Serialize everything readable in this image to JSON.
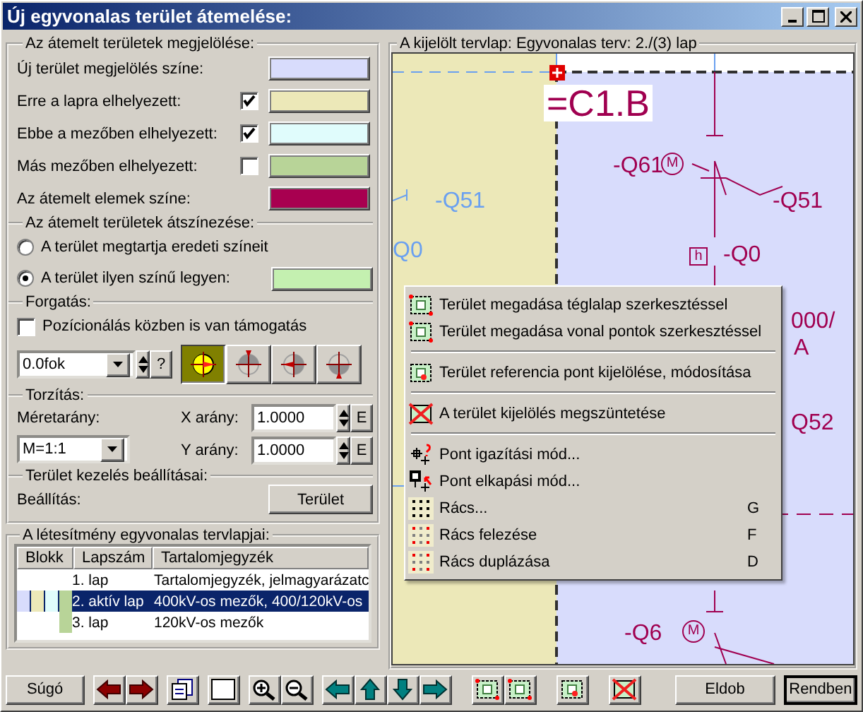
{
  "window": {
    "title": "Új egyvonalas terület átemelése:"
  },
  "marking": {
    "legend": "Az átemelt területek megjelölése:",
    "rows": [
      {
        "kind": "plain",
        "label": "Új terület megjelölés színe:",
        "color": "#d8dcfc"
      },
      {
        "kind": "check",
        "label": "Erre a lapra elhelyezett:",
        "checked": true,
        "color": "#ece8b8"
      },
      {
        "kind": "check",
        "label": "Ebbe a mezőben elhelyezett:",
        "checked": true,
        "color": "#e0fcfc"
      },
      {
        "kind": "check",
        "label": "Más mezőben elhelyezett:",
        "checked": false,
        "color": "#b8d498"
      },
      {
        "kind": "plain",
        "label": "Az átemelt elemek színe:",
        "color": "#a80050"
      }
    ]
  },
  "recolor": {
    "legend": "Az átemelt területek átszínezése:",
    "options": [
      {
        "label": "A terület megtartja eredeti színeit",
        "selected": false
      },
      {
        "label": "A terület ilyen színű legyen:",
        "selected": true,
        "color": "#c4f0b0"
      }
    ]
  },
  "rotation": {
    "legend": "Forgatás:",
    "support": {
      "label": "Pozícionálás közben is van támogatás",
      "checked": false
    },
    "angle": "0.0fok",
    "help": "?",
    "directions": [
      {
        "kind": "right",
        "selected": true
      },
      {
        "kind": "up",
        "selected": false
      },
      {
        "kind": "left",
        "selected": false
      },
      {
        "kind": "down",
        "selected": false
      }
    ]
  },
  "distortion": {
    "legend": "Torzítás:",
    "scale_label": "Méretarány:",
    "scale": "M=1:1",
    "ratios": [
      {
        "label": "X arány:",
        "value": "1.0000",
        "button": "E"
      },
      {
        "label": "Y arány:",
        "value": "1.0000",
        "button": "E"
      }
    ]
  },
  "settings": {
    "legend": "Terület kezelés beállításai:",
    "label": "Beállítás:",
    "button": "Terület"
  },
  "sheets": {
    "legend": "A létesítmény egyvonalas tervlapjai:",
    "columns": [
      "Blokk",
      "Lapszám",
      "Tartalomjegyzék"
    ],
    "rows": [
      {
        "number": "1. lap",
        "content": "Tartalomjegyzék, jelmagyarázatc",
        "selected": false
      },
      {
        "number": "2. aktív lap",
        "content": "400kV-os mezők, 400/120kV-os",
        "selected": true,
        "blocks": [
          {
            "color": "#d8dcfc"
          },
          {
            "color": "#ece8b8"
          },
          {
            "color": "#e0fcfc"
          },
          {
            "color": "#b8d498"
          }
        ]
      },
      {
        "number": "3. lap",
        "content": "120kV-os mezők",
        "selected": false,
        "blocks": [
          {
            "color": "#b8d498"
          }
        ]
      }
    ]
  },
  "preview": {
    "legend": "A kijelölt tervlap: Egyvonalas terv: 2./(3) lap",
    "labels": [
      {
        "kind": "title",
        "text": "=C1.B"
      },
      {
        "kind": "other",
        "text": "-Q51"
      },
      {
        "kind": "other",
        "text": "Q0"
      },
      {
        "kind": "active",
        "text": "-Q61"
      },
      {
        "kind": "motor",
        "text": "M"
      },
      {
        "kind": "active",
        "text": "-Q51"
      },
      {
        "kind": "box",
        "text": "h"
      },
      {
        "kind": "active",
        "text": "-Q0"
      },
      {
        "kind": "active",
        "text": "000/"
      },
      {
        "kind": "active",
        "text": "A"
      },
      {
        "kind": "active",
        "text": "Q52"
      },
      {
        "kind": "active",
        "text": "-Q6"
      },
      {
        "kind": "motor",
        "text": "M"
      }
    ]
  },
  "context_menu": {
    "items": [
      {
        "kind": "item",
        "label": "Terület megadása téglalap szerkesztéssel"
      },
      {
        "kind": "item",
        "label": "Terület megadása vonal pontok szerkesztéssel"
      },
      {
        "kind": "separator"
      },
      {
        "kind": "item",
        "label": "Terület referencia pont kijelölése, módosítása"
      },
      {
        "kind": "separator"
      },
      {
        "kind": "item",
        "label": "A terület kijelölés megszüntetése"
      },
      {
        "kind": "separator"
      },
      {
        "kind": "item",
        "label": "Pont igazítási mód..."
      },
      {
        "kind": "item",
        "label": "Pont elkapási mód..."
      },
      {
        "kind": "item",
        "label": "Rács...",
        "shortcut": "G"
      },
      {
        "kind": "item",
        "label": "Rács felezése",
        "shortcut": "F"
      },
      {
        "kind": "item",
        "label": "Rács duplázása",
        "shortcut": "D"
      }
    ]
  },
  "toolbar": {
    "help": "Súgó",
    "discard": "Eldob",
    "ok": "Rendben"
  }
}
